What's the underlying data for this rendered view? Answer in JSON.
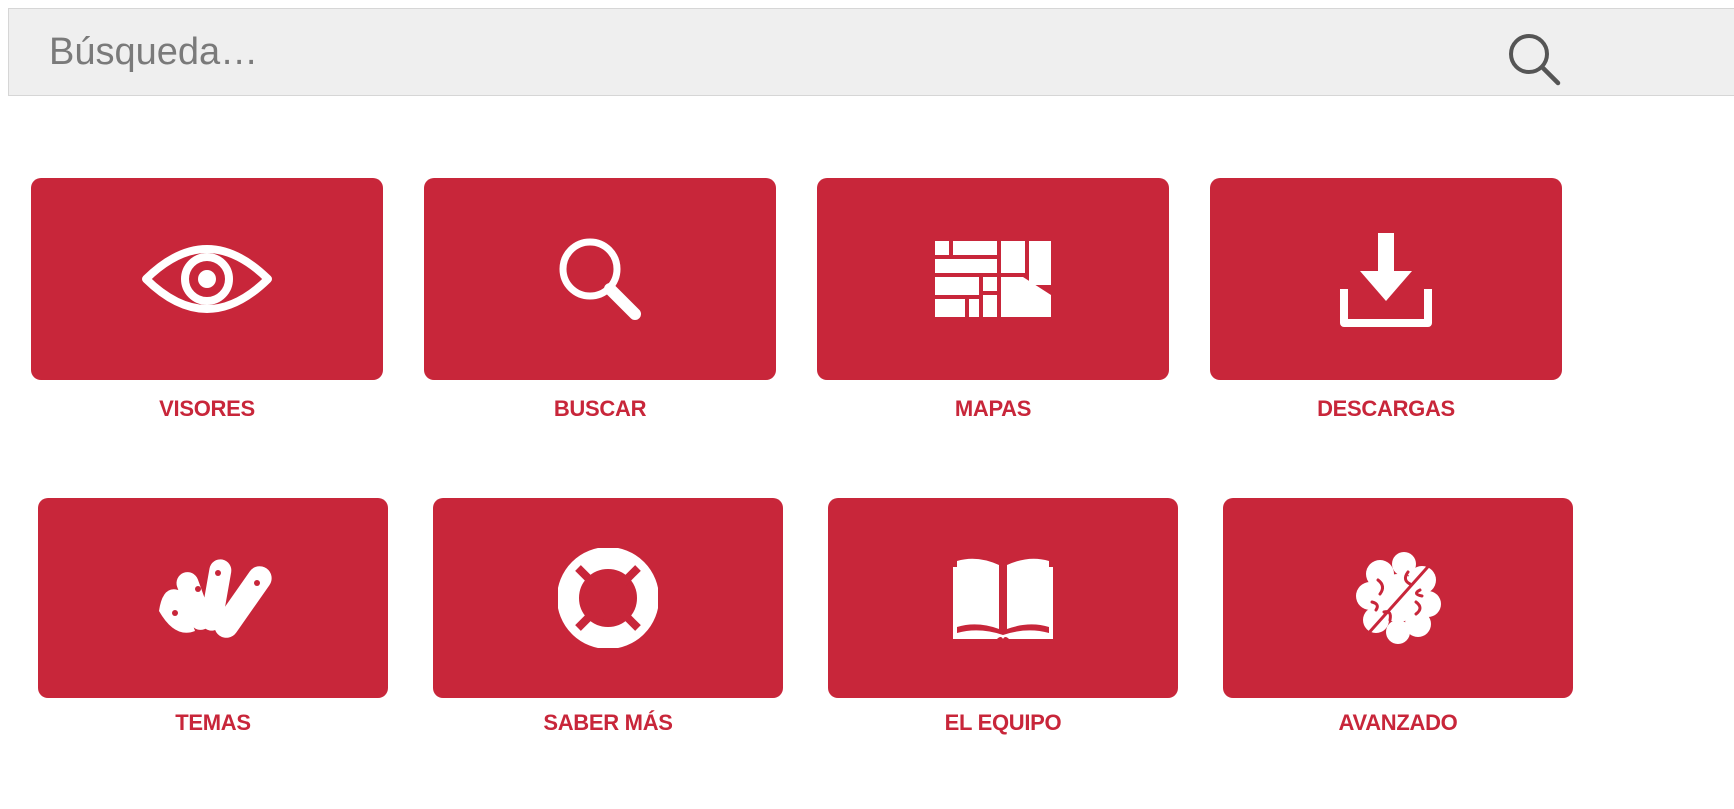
{
  "search": {
    "placeholder": "Búsqueda…",
    "icon": "search-icon"
  },
  "tiles": [
    {
      "label": "VISORES",
      "icon": "eye-icon"
    },
    {
      "label": "BUSCAR",
      "icon": "magnifier-icon"
    },
    {
      "label": "MAPAS",
      "icon": "map-blocks-icon"
    },
    {
      "label": "DESCARGAS",
      "icon": "download-icon"
    },
    {
      "label": "TEMAS",
      "icon": "color-swatches-icon"
    },
    {
      "label": "SABER MÁS",
      "icon": "lifebuoy-icon"
    },
    {
      "label": "EL EQUIPO",
      "icon": "open-book-icon"
    },
    {
      "label": "AVANZADO",
      "icon": "brain-icon"
    }
  ],
  "colors": {
    "accent": "#c8263a",
    "search_bg": "#efefef",
    "text_muted": "#7a7a7a",
    "icon_fill": "#ffffff"
  }
}
